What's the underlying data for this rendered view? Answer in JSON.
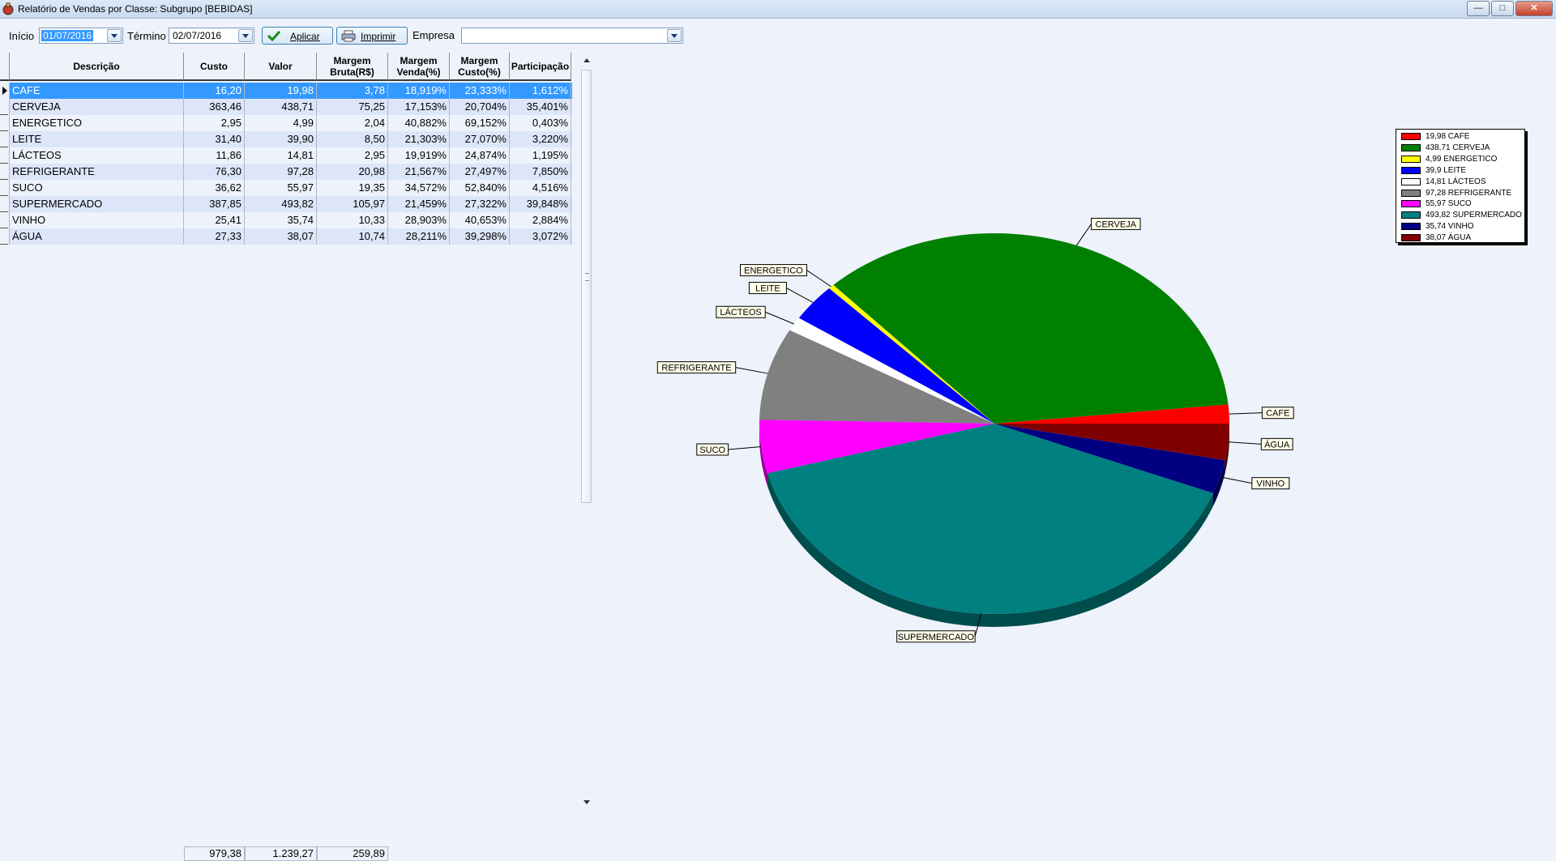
{
  "window": {
    "title": "Relatório de Vendas por Classe: Subgrupo [BEBIDAS]"
  },
  "toolbar": {
    "inicio_label": "Início",
    "inicio_value": "01/07/2016",
    "termino_label": "Término",
    "termino_value": "02/07/2016",
    "aplicar_label": "Aplicar",
    "imprimir_label": "Imprimir",
    "empresa_label": "Empresa",
    "empresa_value": ""
  },
  "grid": {
    "columns": [
      "Descrição",
      "Custo",
      "Valor",
      "Margem Bruta(R$)",
      "Margem Venda(%)",
      "Margem Custo(%)",
      "Participação"
    ],
    "col_line1": [
      "Descrição",
      "Custo",
      "Valor",
      "Margem",
      "Margem",
      "Margem",
      "Participação"
    ],
    "col_line2": [
      "",
      "",
      "",
      "Bruta(R$)",
      "Venda(%)",
      "Custo(%)",
      ""
    ],
    "rows": [
      [
        "CAFE",
        "16,20",
        "19,98",
        "3,78",
        "18,919%",
        "23,333%",
        "1,612%"
      ],
      [
        "CERVEJA",
        "363,46",
        "438,71",
        "75,25",
        "17,153%",
        "20,704%",
        "35,401%"
      ],
      [
        "ENERGETICO",
        "2,95",
        "4,99",
        "2,04",
        "40,882%",
        "69,152%",
        "0,403%"
      ],
      [
        "LEITE",
        "31,40",
        "39,90",
        "8,50",
        "21,303%",
        "27,070%",
        "3,220%"
      ],
      [
        "LÁCTEOS",
        "11,86",
        "14,81",
        "2,95",
        "19,919%",
        "24,874%",
        "1,195%"
      ],
      [
        "REFRIGERANTE",
        "76,30",
        "97,28",
        "20,98",
        "21,567%",
        "27,497%",
        "7,850%"
      ],
      [
        "SUCO",
        "36,62",
        "55,97",
        "19,35",
        "34,572%",
        "52,840%",
        "4,516%"
      ],
      [
        "SUPERMERCADO",
        "387,85",
        "493,82",
        "105,97",
        "21,459%",
        "27,322%",
        "39,848%"
      ],
      [
        "VINHO",
        "25,41",
        "35,74",
        "10,33",
        "28,903%",
        "40,653%",
        "2,884%"
      ],
      [
        "ÁGUA",
        "27,33",
        "38,07",
        "10,74",
        "28,211%",
        "39,298%",
        "3,072%"
      ]
    ],
    "selected_row": 0,
    "totals": {
      "custo": "979,38",
      "valor": "1.239,27",
      "margem_bruta": "259,89"
    }
  },
  "chart_data": {
    "type": "pie",
    "categories": [
      "CAFE",
      "CERVEJA",
      "ENERGETICO",
      "LEITE",
      "LÁCTEOS",
      "REFRIGERANTE",
      "SUCO",
      "SUPERMERCADO",
      "VINHO",
      "ÁGUA"
    ],
    "values": [
      19.98,
      438.71,
      4.99,
      39.9,
      14.81,
      97.28,
      55.97,
      493.82,
      35.74,
      38.07
    ],
    "colors": [
      "#ff0000",
      "#008000",
      "#ffff00",
      "#0000ff",
      "#ffffff",
      "#808080",
      "#ff00ff",
      "#008080",
      "#000080",
      "#800000"
    ],
    "legend_entries": [
      "19,98 CAFE",
      "438,71 CERVEJA",
      "4,99 ENERGETICO",
      "39,9 LEITE",
      "14,81 LÁCTEOS",
      "97,28 REFRIGERANTE",
      "55,97 SUCO",
      "493,82 SUPERMERCADO",
      "35,74 VINHO",
      "38,07 ÁGUA"
    ],
    "legend_position": "top-right",
    "style": "3d"
  }
}
